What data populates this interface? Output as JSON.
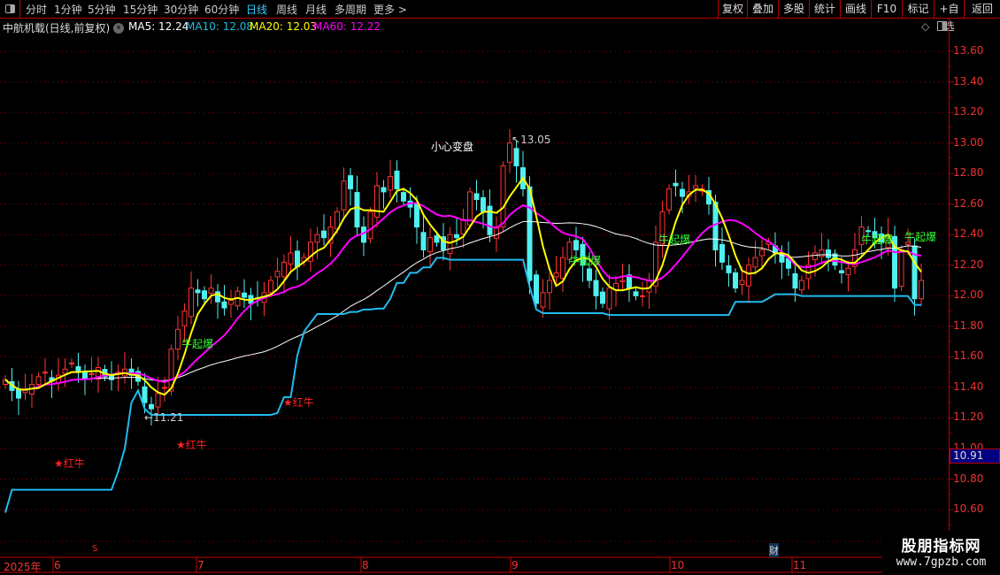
{
  "toolbar": {
    "periods": [
      "分时",
      "1分钟",
      "5分钟",
      "15分钟",
      "30分钟",
      "60分钟",
      "日线",
      "周线",
      "月线",
      "多周期",
      "更多 >"
    ],
    "active_period": "日线",
    "buttons": [
      "复权",
      "叠加",
      "多股",
      "统计",
      "画线",
      "F10",
      "标记",
      "+自选",
      "返回"
    ]
  },
  "info": {
    "title": "中航机载(日线,前复权)",
    "ma5": "MA5: 12.24",
    "ma10": "MA10: 12.08",
    "ma20": "MA20: 12.03",
    "ma60": "MA60: 12.22"
  },
  "colors": {
    "up": "#ff3333",
    "down": "#4ff0f0",
    "ma_fast": "#ffff00",
    "ma_mid": "#ff00ff",
    "ma_slow": "#ffffff",
    "support": "#22bbee",
    "grid": "#a00000"
  },
  "axis": {
    "ticks": [
      "13.60",
      "13.40",
      "13.20",
      "13.00",
      "12.80",
      "12.60",
      "12.40",
      "12.20",
      "12.00",
      "11.80",
      "11.60",
      "11.40",
      "11.20",
      "11.00",
      "10.80",
      "10.60"
    ],
    "current_price": "10.91",
    "dates": [
      "2025年",
      "6",
      "7",
      "8",
      "9",
      "10",
      "11"
    ]
  },
  "annotations": {
    "warn": "小心变盘",
    "high": "13.05",
    "low": "11.21",
    "bull_burst": "牛起爆",
    "red_bull": "★红牛",
    "s_marker": "S",
    "finance_marker": "财"
  },
  "watermark": {
    "name": "股朋指标网",
    "url": "www.7gpzb.com"
  },
  "chart_data": {
    "type": "candlestick",
    "title": "中航机载(日线,前复权)",
    "ylim": [
      10.5,
      13.7
    ],
    "xlabel": "",
    "ylabel": "",
    "closes": [
      11.45,
      11.38,
      11.33,
      11.38,
      11.42,
      11.47,
      11.5,
      11.44,
      11.48,
      11.52,
      11.56,
      11.5,
      11.46,
      11.49,
      11.53,
      11.47,
      11.45,
      11.5,
      11.52,
      11.48,
      11.44,
      11.3,
      11.26,
      11.36,
      11.4,
      11.65,
      11.78,
      11.9,
      12.05,
      12.02,
      11.98,
      12.05,
      11.96,
      11.92,
      11.97,
      12.03,
      11.99,
      11.95,
      11.98,
      12.02,
      12.1,
      12.16,
      12.22,
      12.28,
      12.19,
      12.25,
      12.35,
      12.4,
      12.38,
      12.45,
      12.55,
      12.75,
      12.7,
      12.45,
      12.35,
      12.55,
      12.72,
      12.68,
      12.78,
      12.7,
      12.62,
      12.58,
      12.45,
      12.3,
      12.38,
      12.35,
      12.3,
      12.4,
      12.38,
      12.5,
      12.68,
      12.63,
      12.55,
      12.4,
      12.45,
      12.85,
      13.0,
      12.85,
      12.7,
      12.1,
      11.95,
      12.02,
      12.1,
      12.15,
      12.25,
      12.35,
      12.3,
      12.2,
      12.1,
      12.0,
      11.95,
      12.05,
      12.08,
      12.1,
      12.05,
      12.0,
      12.0,
      12.1,
      12.35,
      12.55,
      12.7,
      12.72,
      12.65,
      12.68,
      12.72,
      12.7,
      12.6,
      12.3,
      12.22,
      12.15,
      12.05,
      12.1,
      12.2,
      12.25,
      12.3,
      12.35,
      12.28,
      12.22,
      12.18,
      12.05,
      12.1,
      12.2,
      12.28,
      12.3,
      12.25,
      12.2,
      12.15,
      12.18,
      12.3,
      12.45,
      12.42,
      12.38,
      12.35,
      12.4,
      12.05,
      12.3,
      12.35,
      11.98,
      12.1
    ],
    "ma_periods": {
      "fast": 5,
      "mid": 13,
      "slow": 40
    },
    "support_levels": [
      10.58,
      10.73,
      10.73,
      10.73,
      10.73,
      10.73,
      10.73,
      10.73,
      10.73,
      10.73,
      10.73,
      10.73,
      10.73,
      10.73,
      10.73,
      10.73,
      10.73,
      10.85,
      11.0,
      11.3,
      11.38
    ]
  }
}
